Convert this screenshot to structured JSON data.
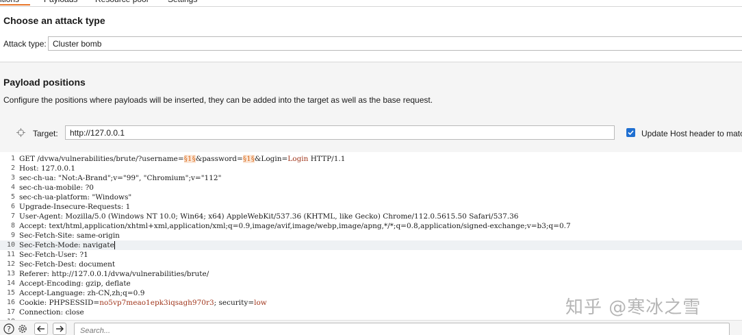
{
  "tabs": [
    {
      "label": "itions",
      "active": true
    },
    {
      "label": "Payloads",
      "active": false
    },
    {
      "label": "Resource pool",
      "active": false
    },
    {
      "label": "Settings",
      "active": false
    }
  ],
  "attack": {
    "title": "Choose an attack type",
    "label": "Attack type:",
    "value": "Cluster bomb"
  },
  "positions": {
    "title": "Payload positions",
    "description": "Configure the positions where payloads will be inserted, they can be added into the target as well as the base request."
  },
  "target": {
    "label": "Target:",
    "value": "http://127.0.0.1",
    "update_host_label": "Update Host header to matc",
    "update_host_checked": true
  },
  "request_lines": [
    {
      "n": "1",
      "parts": [
        [
          "t",
          "GET /dvwa/vulnerabilities/brute/?username="
        ],
        [
          "m",
          "§1§"
        ],
        [
          "t",
          "&password="
        ],
        [
          "m",
          "§1§"
        ],
        [
          "t",
          "&Login="
        ],
        [
          "p",
          "Login"
        ],
        [
          "t",
          " HTTP/1.1"
        ]
      ]
    },
    {
      "n": "2",
      "parts": [
        [
          "t",
          "Host: 127.0.0.1"
        ]
      ]
    },
    {
      "n": "3",
      "parts": [
        [
          "t",
          "sec-ch-ua: \"Not:A-Brand\";v=\"99\", \"Chromium\";v=\"112\""
        ]
      ]
    },
    {
      "n": "4",
      "parts": [
        [
          "t",
          "sec-ch-ua-mobile: ?0"
        ]
      ]
    },
    {
      "n": "5",
      "parts": [
        [
          "t",
          "sec-ch-ua-platform: \"Windows\""
        ]
      ]
    },
    {
      "n": "6",
      "parts": [
        [
          "t",
          "Upgrade-Insecure-Requests: 1"
        ]
      ]
    },
    {
      "n": "7",
      "parts": [
        [
          "t",
          "User-Agent: Mozilla/5.0 (Windows NT 10.0; Win64; x64) AppleWebKit/537.36 (KHTML, like Gecko) Chrome/112.0.5615.50 Safari/537.36"
        ]
      ]
    },
    {
      "n": "8",
      "parts": [
        [
          "t",
          "Accept: text/html,application/xhtml+xml,application/xml;q=0.9,image/avif,image/webp,image/apng,*/*;q=0.8,application/signed-exchange;v=b3;q=0.7"
        ]
      ]
    },
    {
      "n": "9",
      "parts": [
        [
          "t",
          "Sec-Fetch-Site: same-origin"
        ]
      ]
    },
    {
      "n": "10",
      "parts": [
        [
          "t",
          "Sec-Fetch-Mode: navigate"
        ]
      ],
      "cursor": true
    },
    {
      "n": "11",
      "parts": [
        [
          "t",
          "Sec-Fetch-User: ?1"
        ]
      ]
    },
    {
      "n": "12",
      "parts": [
        [
          "t",
          "Sec-Fetch-Dest: document"
        ]
      ]
    },
    {
      "n": "13",
      "parts": [
        [
          "t",
          "Referer: http://127.0.0.1/dvwa/vulnerabilities/brute/"
        ]
      ]
    },
    {
      "n": "14",
      "parts": [
        [
          "t",
          "Accept-Encoding: gzip, deflate"
        ]
      ]
    },
    {
      "n": "15",
      "parts": [
        [
          "t",
          "Accept-Language: zh-CN,zh;q=0.9"
        ]
      ]
    },
    {
      "n": "16",
      "parts": [
        [
          "t",
          "Cookie: PHPSESSID="
        ],
        [
          "p",
          "no5vp7meao1epk3iqsagh970r3"
        ],
        [
          "t",
          "; security="
        ],
        [
          "p",
          "low"
        ]
      ]
    },
    {
      "n": "17",
      "parts": [
        [
          "t",
          "Connection: close"
        ]
      ]
    },
    {
      "n": "18",
      "parts": [
        [
          "t",
          ""
        ]
      ]
    }
  ],
  "bottom": {
    "search_placeholder": "Search..."
  },
  "watermark": "知乎 @寒冰之雪",
  "colors": {
    "accent_tab": "#e8762b",
    "checkbox": "#1f6fd1",
    "payload_marker": "#d8691b",
    "param_value": "#a0361c"
  },
  "icons": [
    "crosshair-icon",
    "checkbox-checked-icon",
    "help-icon",
    "gear-icon",
    "arrow-left-icon",
    "arrow-right-icon"
  ]
}
